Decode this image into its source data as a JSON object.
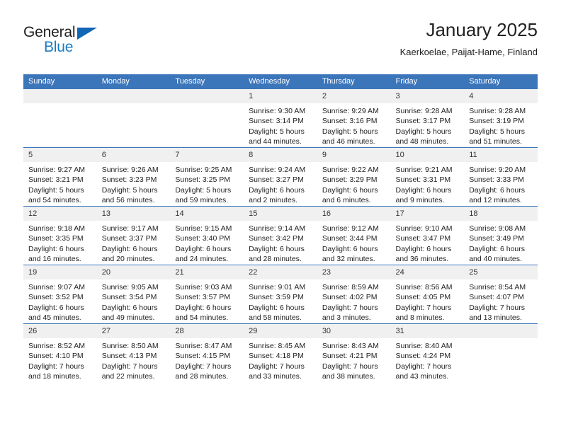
{
  "logo": {
    "word1": "General",
    "word2": "Blue",
    "triangle_color": "#1266b5",
    "word2_color": "#1a7bc4"
  },
  "header": {
    "title": "January 2025",
    "subtitle": "Kaerkoelae, Paijat-Hame, Finland"
  },
  "theme": {
    "header_bg": "#3b75ba",
    "header_text": "#ffffff",
    "daynum_bg": "#f0f0f0",
    "row_divider": "#3b75ba"
  },
  "calendar": {
    "weekday_headers": [
      "Sunday",
      "Monday",
      "Tuesday",
      "Wednesday",
      "Thursday",
      "Friday",
      "Saturday"
    ],
    "weeks": [
      [
        {
          "day": "",
          "lines": []
        },
        {
          "day": "",
          "lines": []
        },
        {
          "day": "",
          "lines": []
        },
        {
          "day": "1",
          "lines": [
            "Sunrise: 9:30 AM",
            "Sunset: 3:14 PM",
            "Daylight: 5 hours",
            "and 44 minutes."
          ]
        },
        {
          "day": "2",
          "lines": [
            "Sunrise: 9:29 AM",
            "Sunset: 3:16 PM",
            "Daylight: 5 hours",
            "and 46 minutes."
          ]
        },
        {
          "day": "3",
          "lines": [
            "Sunrise: 9:28 AM",
            "Sunset: 3:17 PM",
            "Daylight: 5 hours",
            "and 48 minutes."
          ]
        },
        {
          "day": "4",
          "lines": [
            "Sunrise: 9:28 AM",
            "Sunset: 3:19 PM",
            "Daylight: 5 hours",
            "and 51 minutes."
          ]
        }
      ],
      [
        {
          "day": "5",
          "lines": [
            "Sunrise: 9:27 AM",
            "Sunset: 3:21 PM",
            "Daylight: 5 hours",
            "and 54 minutes."
          ]
        },
        {
          "day": "6",
          "lines": [
            "Sunrise: 9:26 AM",
            "Sunset: 3:23 PM",
            "Daylight: 5 hours",
            "and 56 minutes."
          ]
        },
        {
          "day": "7",
          "lines": [
            "Sunrise: 9:25 AM",
            "Sunset: 3:25 PM",
            "Daylight: 5 hours",
            "and 59 minutes."
          ]
        },
        {
          "day": "8",
          "lines": [
            "Sunrise: 9:24 AM",
            "Sunset: 3:27 PM",
            "Daylight: 6 hours",
            "and 2 minutes."
          ]
        },
        {
          "day": "9",
          "lines": [
            "Sunrise: 9:22 AM",
            "Sunset: 3:29 PM",
            "Daylight: 6 hours",
            "and 6 minutes."
          ]
        },
        {
          "day": "10",
          "lines": [
            "Sunrise: 9:21 AM",
            "Sunset: 3:31 PM",
            "Daylight: 6 hours",
            "and 9 minutes."
          ]
        },
        {
          "day": "11",
          "lines": [
            "Sunrise: 9:20 AM",
            "Sunset: 3:33 PM",
            "Daylight: 6 hours",
            "and 12 minutes."
          ]
        }
      ],
      [
        {
          "day": "12",
          "lines": [
            "Sunrise: 9:18 AM",
            "Sunset: 3:35 PM",
            "Daylight: 6 hours",
            "and 16 minutes."
          ]
        },
        {
          "day": "13",
          "lines": [
            "Sunrise: 9:17 AM",
            "Sunset: 3:37 PM",
            "Daylight: 6 hours",
            "and 20 minutes."
          ]
        },
        {
          "day": "14",
          "lines": [
            "Sunrise: 9:15 AM",
            "Sunset: 3:40 PM",
            "Daylight: 6 hours",
            "and 24 minutes."
          ]
        },
        {
          "day": "15",
          "lines": [
            "Sunrise: 9:14 AM",
            "Sunset: 3:42 PM",
            "Daylight: 6 hours",
            "and 28 minutes."
          ]
        },
        {
          "day": "16",
          "lines": [
            "Sunrise: 9:12 AM",
            "Sunset: 3:44 PM",
            "Daylight: 6 hours",
            "and 32 minutes."
          ]
        },
        {
          "day": "17",
          "lines": [
            "Sunrise: 9:10 AM",
            "Sunset: 3:47 PM",
            "Daylight: 6 hours",
            "and 36 minutes."
          ]
        },
        {
          "day": "18",
          "lines": [
            "Sunrise: 9:08 AM",
            "Sunset: 3:49 PM",
            "Daylight: 6 hours",
            "and 40 minutes."
          ]
        }
      ],
      [
        {
          "day": "19",
          "lines": [
            "Sunrise: 9:07 AM",
            "Sunset: 3:52 PM",
            "Daylight: 6 hours",
            "and 45 minutes."
          ]
        },
        {
          "day": "20",
          "lines": [
            "Sunrise: 9:05 AM",
            "Sunset: 3:54 PM",
            "Daylight: 6 hours",
            "and 49 minutes."
          ]
        },
        {
          "day": "21",
          "lines": [
            "Sunrise: 9:03 AM",
            "Sunset: 3:57 PM",
            "Daylight: 6 hours",
            "and 54 minutes."
          ]
        },
        {
          "day": "22",
          "lines": [
            "Sunrise: 9:01 AM",
            "Sunset: 3:59 PM",
            "Daylight: 6 hours",
            "and 58 minutes."
          ]
        },
        {
          "day": "23",
          "lines": [
            "Sunrise: 8:59 AM",
            "Sunset: 4:02 PM",
            "Daylight: 7 hours",
            "and 3 minutes."
          ]
        },
        {
          "day": "24",
          "lines": [
            "Sunrise: 8:56 AM",
            "Sunset: 4:05 PM",
            "Daylight: 7 hours",
            "and 8 minutes."
          ]
        },
        {
          "day": "25",
          "lines": [
            "Sunrise: 8:54 AM",
            "Sunset: 4:07 PM",
            "Daylight: 7 hours",
            "and 13 minutes."
          ]
        }
      ],
      [
        {
          "day": "26",
          "lines": [
            "Sunrise: 8:52 AM",
            "Sunset: 4:10 PM",
            "Daylight: 7 hours",
            "and 18 minutes."
          ]
        },
        {
          "day": "27",
          "lines": [
            "Sunrise: 8:50 AM",
            "Sunset: 4:13 PM",
            "Daylight: 7 hours",
            "and 22 minutes."
          ]
        },
        {
          "day": "28",
          "lines": [
            "Sunrise: 8:47 AM",
            "Sunset: 4:15 PM",
            "Daylight: 7 hours",
            "and 28 minutes."
          ]
        },
        {
          "day": "29",
          "lines": [
            "Sunrise: 8:45 AM",
            "Sunset: 4:18 PM",
            "Daylight: 7 hours",
            "and 33 minutes."
          ]
        },
        {
          "day": "30",
          "lines": [
            "Sunrise: 8:43 AM",
            "Sunset: 4:21 PM",
            "Daylight: 7 hours",
            "and 38 minutes."
          ]
        },
        {
          "day": "31",
          "lines": [
            "Sunrise: 8:40 AM",
            "Sunset: 4:24 PM",
            "Daylight: 7 hours",
            "and 43 minutes."
          ]
        },
        {
          "day": "",
          "lines": []
        }
      ]
    ]
  }
}
